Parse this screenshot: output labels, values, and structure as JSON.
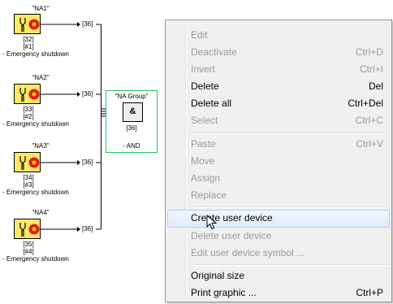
{
  "diagram": {
    "devices": [
      {
        "name": "\"NA1\"",
        "link": "[36]",
        "number": "[32]",
        "id": "[#1]",
        "desc": "- Emergency shutdown"
      },
      {
        "name": "\"NA2\"",
        "link": "[36]",
        "number": "[33]",
        "id": "[#2]",
        "desc": "- Emergency shutdown"
      },
      {
        "name": "\"NA3\"",
        "link": "[36]",
        "number": "[34]",
        "id": "[#3]",
        "desc": "- Emergency shutdown"
      },
      {
        "name": "\"NA4\"",
        "link": "[36]",
        "number": "[35]",
        "id": "[#4]",
        "desc": "- Emergency shutdown"
      }
    ],
    "group": {
      "name": "\"NA Group\"",
      "symbol": "&",
      "number": "[36]",
      "type": "- AND"
    }
  },
  "menu": {
    "items": [
      {
        "label": "Edit",
        "shortcut": "",
        "disabled": true
      },
      {
        "label": "Deactivate",
        "shortcut": "Ctrl+D",
        "disabled": true
      },
      {
        "label": "Invert",
        "shortcut": "Ctrl+I",
        "disabled": true
      },
      {
        "label": "Delete",
        "shortcut": "Del",
        "disabled": false
      },
      {
        "label": "Delete all",
        "shortcut": "Ctrl+Del",
        "disabled": false
      },
      {
        "label": "Select",
        "shortcut": "Ctrl+C",
        "disabled": true
      },
      {
        "label": "Paste",
        "shortcut": "Ctrl+V",
        "disabled": true
      },
      {
        "label": "Move",
        "shortcut": "",
        "disabled": true
      },
      {
        "label": "Assign",
        "shortcut": "",
        "disabled": true
      },
      {
        "label": "Replace",
        "shortcut": "",
        "disabled": true
      },
      {
        "label": "Create user device",
        "shortcut": "",
        "disabled": false
      },
      {
        "label": "Delete user device",
        "shortcut": "",
        "disabled": true
      },
      {
        "label": "Edit user device symbol ...",
        "shortcut": "",
        "disabled": true
      },
      {
        "label": "Original size",
        "shortcut": "",
        "disabled": false
      },
      {
        "label": "Print graphic ...",
        "shortcut": "Ctrl+P",
        "disabled": false
      }
    ]
  }
}
